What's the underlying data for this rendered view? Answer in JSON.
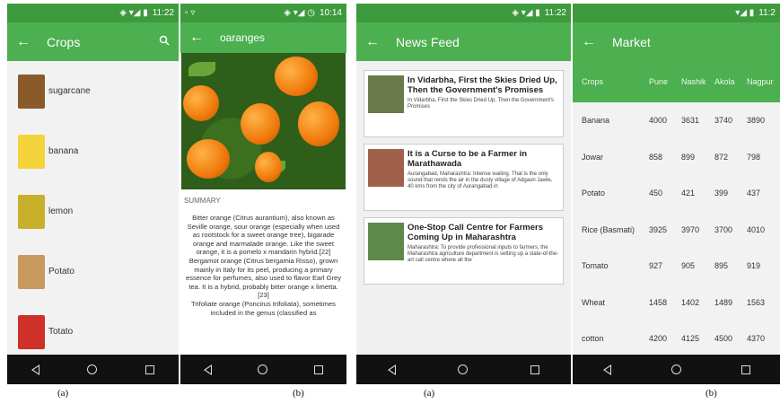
{
  "screen1": {
    "status": {
      "icons": "◈ ▾◢ ▮",
      "time": "11:22"
    },
    "title": "Crops",
    "icons": {
      "back": "arrow-left-icon",
      "search": "search-icon"
    },
    "items": [
      {
        "label": "sugarcane",
        "color": "#8b5a2b"
      },
      {
        "label": "banana",
        "color": "#f5d33a"
      },
      {
        "label": "lemon",
        "color": "#c8b02a"
      },
      {
        "label": "Potato",
        "color": "#c99a5e"
      },
      {
        "label": "Totato",
        "color": "#d0302a"
      }
    ],
    "caption": "(a)"
  },
  "screen2": {
    "status": {
      "left": "▫ ▿",
      "icons": "◈ ▾◢ ◷",
      "time": "10:14"
    },
    "title": "oaranges",
    "summary_heading": "SUMMARY",
    "summary": [
      "Bitter orange (Citrus aurantium), also known as Seville orange, sour orange (especially when used as rootstock for a sweet orange tree), bigarade orange and marmalade orange. Like the sweet orange, it is a pomelo x mandarin hybrid.[22]",
      "Bergamot orange (Citrus bergamia Risso), grown mainly in Italy for its peel, producing a primary essence for perfumes, also used to flavor Earl Grey tea. It is a hybrid, probably bitter orange x limetta.[23]",
      "Trifoliate orange (Poncirus trifoliata), sometimes included in the genus (classified as"
    ],
    "caption": "(b)"
  },
  "screen3": {
    "status": {
      "icons": "◈ ▾◢ ▮",
      "time": "11:22"
    },
    "title": "News Feed",
    "cards": [
      {
        "title": "In Vidarbha, First the Skies Dried Up, Then the Government's Promises",
        "body": "In Vidarbha, First the Skies Dried Up, Then the Government's Promises",
        "color": "#6b7a4a"
      },
      {
        "title": "It is a Curse to be a Farmer in Marathawada",
        "body": "Aurangabad, Maharashtra: Intense wailing. That is the only sound that rends the air in the dusty village of Adgaon Jawle, 40 kms from the city of Aurangabad in",
        "color": "#a0604a"
      },
      {
        "title": "One-Stop Call Centre for Farmers Coming Up in Maharashtra",
        "body": "Maharashtra: To provide professional inputs to farmers, the Maharashtra agriculture department is setting up a state-of-the-art call centre where all the",
        "color": "#5d8a4a"
      }
    ],
    "caption": "(a)"
  },
  "screen4": {
    "status": {
      "icons": "▾◢ ▮",
      "time": "11:2"
    },
    "title": "Market",
    "columns": [
      "Crops",
      "Pune",
      "Nashik",
      "Akola",
      "Nagpur"
    ],
    "rows": [
      [
        "Banana",
        "4000",
        "3631",
        "3740",
        "3890"
      ],
      [
        "Jowar",
        "858",
        "899",
        "872",
        "798"
      ],
      [
        "Potato",
        "450",
        "421",
        "399",
        "437"
      ],
      [
        "Rice (Basmati)",
        "3925",
        "3970",
        "3700",
        "4010"
      ],
      [
        "Tomato",
        "927",
        "905",
        "895",
        "919"
      ],
      [
        "Wheat",
        "1458",
        "1402",
        "1489",
        "1563"
      ],
      [
        "cotton",
        "4200",
        "4125",
        "4500",
        "4370"
      ]
    ],
    "caption": "(b)"
  },
  "colors": {
    "statusbar": "#3d9a3d",
    "appbar": "#4caf50",
    "navbar": "#111111"
  }
}
